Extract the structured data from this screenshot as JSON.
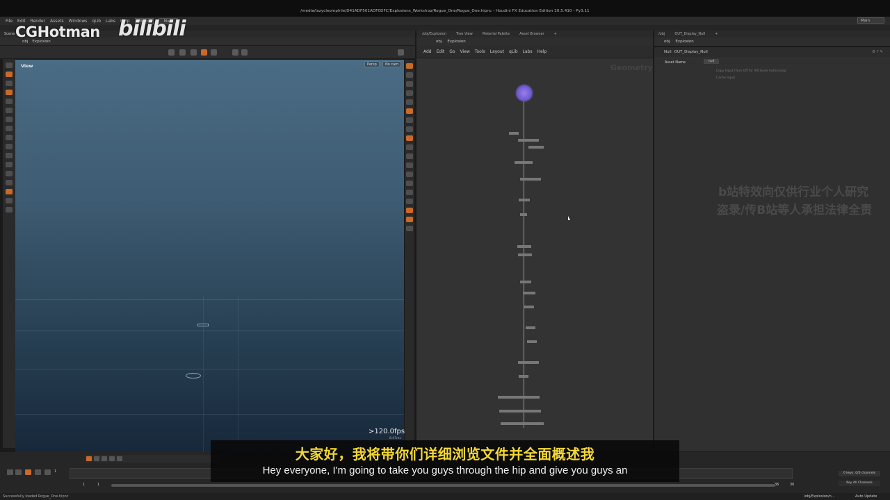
{
  "window": {
    "title": "/media/lazycleomphile/D41ADF501ADF0DFC/Explosions_Workshop/Rogue_One/Rogue_One.hipnc - Houdini FX Education Edition 20.5.410 - Py3.11"
  },
  "menubar": {
    "items": [
      "File",
      "Edit",
      "Render",
      "Assets",
      "Windows",
      "qLib",
      "Labs",
      "Help"
    ],
    "desktop_dropdown": "Build",
    "main_dropdown": "Main",
    "right_dropdown": "Main"
  },
  "watermark": {
    "channel": "CGHotman",
    "site_logo": "bilibili",
    "notice_line1": "b站特效向仅供行业个人研究",
    "notice_line2": "盗录/传B站等人承担法律全责"
  },
  "left_pane": {
    "path": [
      "obj",
      "Explosion"
    ],
    "viewport_label": "View",
    "camera_button": "Persp",
    "cam_button": "No cam",
    "fps": ">120.0fps",
    "fps_sub": "8.47ms",
    "scene_label": "Scene V"
  },
  "network_pane": {
    "tabs": [
      "/obj/Explosion",
      "Tree View",
      "Material Palette",
      "Asset Browser"
    ],
    "path": [
      "obj",
      "Explosion"
    ],
    "menu": [
      "Add",
      "Edit",
      "Go",
      "View",
      "Tools",
      "Layout",
      "qLib",
      "Labs",
      "Help"
    ],
    "context_label": "Geometry"
  },
  "param_pane": {
    "tabs": [
      "/obj",
      "OUT_Display_Null"
    ],
    "path": [
      "obj",
      "Explosion"
    ],
    "node_type": "Null",
    "node_name": "OUT_Display_Null",
    "attr_label": "Asset Name",
    "attr_value": "null",
    "check1": "Copy Input (Turn Off for Attribute Instancing)",
    "check2": "Cache Input"
  },
  "playbar": {
    "frame": "1",
    "start": "1",
    "end": "1",
    "end_frame": "36",
    "end_frame2": "36",
    "keys_label": "0 keys, 0/0 channels",
    "key_all": "Key All Channels",
    "auto_update": "Auto Update",
    "status": "Successfully loaded Rogue_One.hipnc",
    "scene_path": "/obj/Explosion/n..."
  },
  "subtitles": {
    "chinese": "大家好，我将带你们详细浏览文件并全面概述我",
    "english": "Hey everyone, I'm going to take you guys through the hip and give you guys an"
  }
}
